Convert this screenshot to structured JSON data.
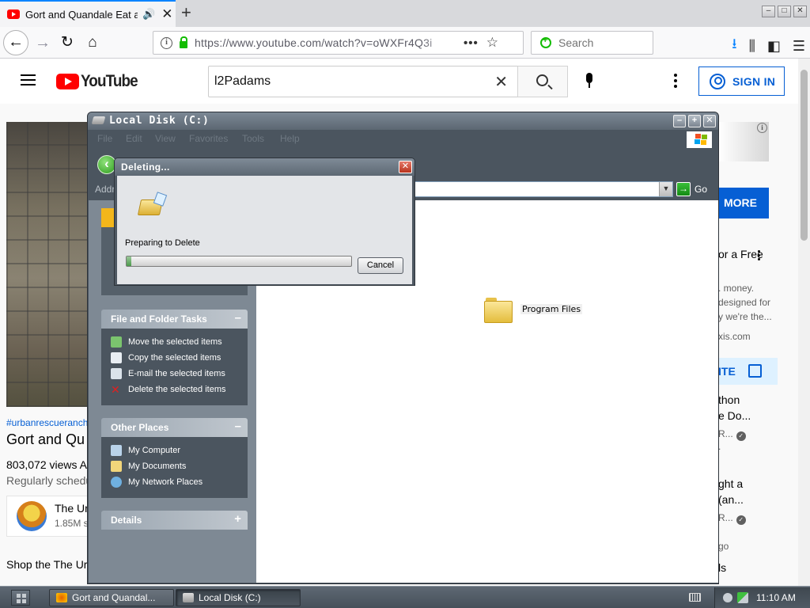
{
  "browser": {
    "tab_title": "Gort and Quandale Eat a",
    "url": "https://www.youtube.com/watch?v=oWXFr4Q3i",
    "search_placeholder": "Search"
  },
  "youtube": {
    "logo": "YouTube",
    "search_query": "l2Padams",
    "sign_in": "SIGN IN",
    "hashtag": "#urbanrescueranch",
    "video_title": "Gort and Qu",
    "views": "803,072 views  A",
    "schedule": "Regularly schedu",
    "channel_name": "The Ur",
    "channel_subs": "1.85M s",
    "shop": "Shop the The Ur",
    "ad": {
      "learn_more": "MORE",
      "headline": "or a Free",
      "desc1": ". money.",
      "desc2": "designed for",
      "desc3": "y we're the...",
      "domain": "xis.com",
      "visit_site": "ITE"
    },
    "related": [
      {
        "line1": "thon",
        "line2": "e Do...",
        "channel": "R...",
        "extra": "."
      },
      {
        "line1": "ght a",
        "line2": "(an...",
        "channel": "R...",
        "extra": "go"
      }
    ],
    "related_last": "ls"
  },
  "explorer": {
    "title": "Local Disk (C:)",
    "menu": [
      "File",
      "Edit",
      "View",
      "Favorites",
      "Tools",
      "Help"
    ],
    "address_label": "Addr",
    "go_label": "Go",
    "file_tasks_header": "File and Folder Tasks",
    "file_tasks": [
      "Move the selected items",
      "Copy the selected items",
      "E-mail the selected items",
      "Delete the selected items"
    ],
    "other_places_header": "Other Places",
    "other_places": [
      "My Computer",
      "My Documents",
      "My Network Places"
    ],
    "details_header": "Details",
    "folder_label": "Program Files"
  },
  "dialog": {
    "title": "Deleting...",
    "status": "Preparing to Delete",
    "cancel": "Cancel",
    "progress": 0.02
  },
  "taskbar": {
    "task1": "Gort and Quandal...",
    "task2": "Local Disk (C:)",
    "clock": "11:10 AM"
  },
  "colors": {
    "accent_blue": "#065fd4",
    "youtube_red": "#ff0000",
    "xp_panel": "#4b555f"
  }
}
